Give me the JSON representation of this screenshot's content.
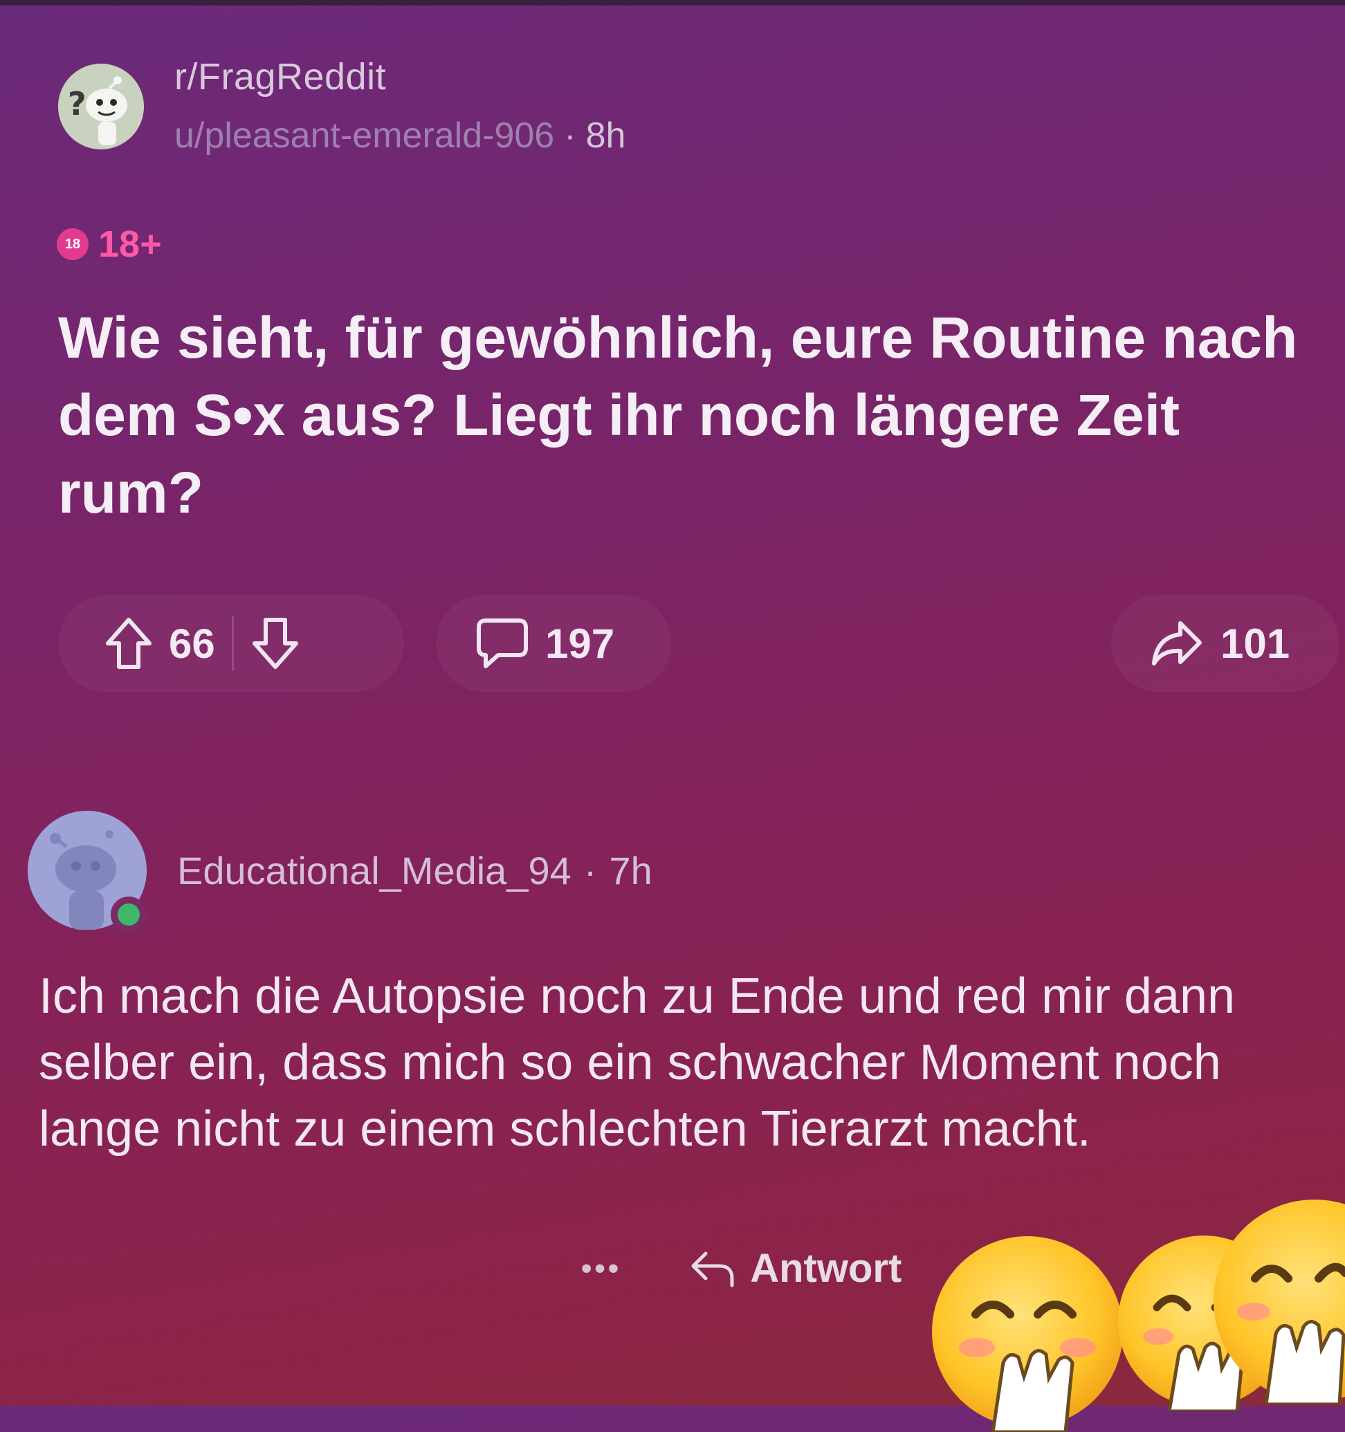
{
  "post": {
    "subreddit": "r/FragReddit",
    "author": "u/pleasant-emerald-906",
    "separator": "·",
    "age": "8h",
    "nsfw_badge_icon": "18",
    "nsfw_label": "18+",
    "title": "Wie sieht, für gewöhnlich, eure Routine nach dem S•x aus? Liegt ihr noch längere Zeit rum?",
    "upvotes": "66",
    "comments": "197",
    "shares": "101"
  },
  "comment": {
    "author": "Educational_Media_94",
    "separator": "·",
    "age": "7h",
    "body": "Ich mach die Autopsie noch zu Ende und red mir dann selber ein, dass mich so ein schwacher Moment noch lange nicht zu einem schlechten Tierarzt macht.",
    "more_label": "•••",
    "reply_label": "Antwort"
  },
  "colors": {
    "background_top": "#6a2a7a",
    "background_bottom": "#8a2a3c",
    "nsfw_accent": "#ff5aa6",
    "online_status": "#3fb86a"
  },
  "icons": {
    "upvote": "arrow-up-icon",
    "downvote": "arrow-down-icon",
    "comments": "speech-bubble-icon",
    "share": "share-arrow-icon",
    "reply": "reply-arrow-icon",
    "overlay": "laughing-emoji-icon"
  }
}
